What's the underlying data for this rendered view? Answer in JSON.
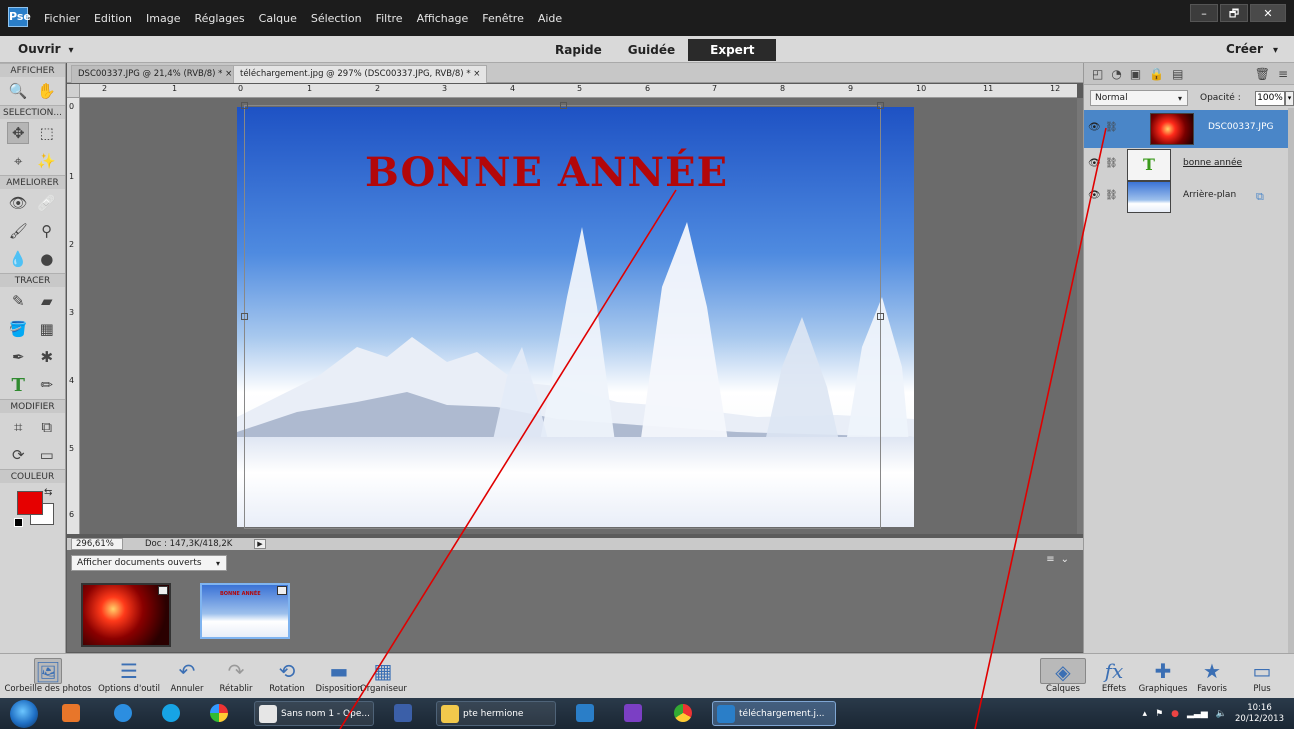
{
  "app": {
    "icon_name": "photoshop-elements-icon",
    "icon_text": "Pse"
  },
  "menu": [
    "Fichier",
    "Edition",
    "Image",
    "Réglages",
    "Calque",
    "Sélection",
    "Filtre",
    "Affichage",
    "Fenêtre",
    "Aide"
  ],
  "window_controls": [
    "–",
    "🗗",
    "✕"
  ],
  "modebar": {
    "open_label": "Ouvrir",
    "modes": [
      "Rapide",
      "Guidée",
      "Expert"
    ],
    "active_mode": "Expert",
    "create_label": "Créer"
  },
  "toolbar": {
    "sections": [
      "AFFICHER",
      "SELECTION...",
      "AMELIORER",
      "TRACER",
      "MODIFIER",
      "COULEUR"
    ],
    "foreground_color": "#e60000",
    "background_color": "#ffffff"
  },
  "tabs": [
    {
      "label": "DSC00337.JPG @ 21,4% (RVB/8) * ×",
      "active": false
    },
    {
      "label": "téléchargement.jpg @ 297% (DSC00337.JPG, RVB/8) * ×",
      "active": true
    }
  ],
  "rulers": {
    "horizontal": [
      "2",
      "1",
      "0",
      "1",
      "2",
      "3",
      "4",
      "5",
      "6",
      "7",
      "8",
      "9",
      "10",
      "11",
      "12"
    ],
    "vertical": [
      "0",
      "1",
      "2",
      "3",
      "4",
      "5",
      "6"
    ]
  },
  "canvas": {
    "image_text": "BONNE ANNÉE",
    "text_color": "#b3070a"
  },
  "status": {
    "zoom": "296,61%",
    "doc_size": "Doc : 147,3K/418,2K"
  },
  "bin": {
    "filter_label": "Afficher documents ouverts",
    "thumbnail_text": "BONNE ANNÉE"
  },
  "layers_panel": {
    "blend_mode": "Normal",
    "opacity_label": "Opacité :",
    "opacity_value": "100%",
    "layers": [
      {
        "name": "DSC00337.JPG",
        "active": true
      },
      {
        "name": "bonne année",
        "active": false
      },
      {
        "name": "Arrière-plan",
        "active": false
      }
    ]
  },
  "bottom_buttons": [
    {
      "label": "Corbeille des photos",
      "icon": "photo-bin-icon",
      "selected": true
    },
    {
      "label": "Options d'outil",
      "icon": "tool-options-icon",
      "selected": false
    },
    {
      "label": "Annuler",
      "icon": "undo-icon",
      "selected": false
    },
    {
      "label": "Rétablir",
      "icon": "redo-icon",
      "selected": false
    },
    {
      "label": "Rotation",
      "icon": "rotate-icon",
      "selected": false
    },
    {
      "label": "Disposition",
      "icon": "layout-icon",
      "selected": false
    },
    {
      "label": "Organiseur",
      "icon": "organizer-icon",
      "selected": false
    },
    {
      "label": "Calques",
      "icon": "layers-icon",
      "selected": true
    },
    {
      "label": "Effets",
      "icon": "fx-icon",
      "selected": false
    },
    {
      "label": "Graphiques",
      "icon": "graphics-plus-icon",
      "selected": false
    },
    {
      "label": "Favoris",
      "icon": "star-icon",
      "selected": false
    },
    {
      "label": "Plus",
      "icon": "more-icon",
      "selected": false
    }
  ],
  "taskbar": {
    "items": [
      "Sans nom 1 - Ope...",
      "pte hermione",
      "téléchargement.j..."
    ],
    "clock_time": "10:16",
    "clock_date": "20/12/2013"
  },
  "colors": {
    "accent_blue": "#4a86c8",
    "annotation_red": "#e00000"
  }
}
